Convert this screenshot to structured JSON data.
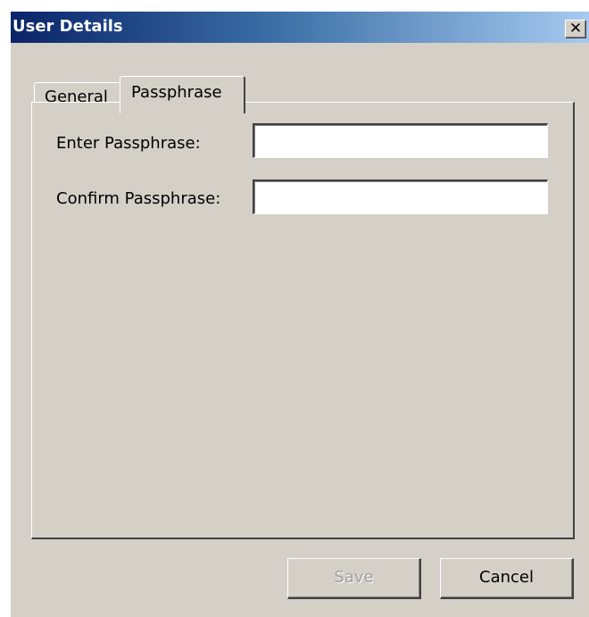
{
  "window": {
    "title": "User Details",
    "close_glyph": "✕"
  },
  "tabs": [
    {
      "label": "General",
      "selected": false
    },
    {
      "label": "Passphrase",
      "selected": true
    }
  ],
  "form": {
    "enter_label": "Enter Passphrase:",
    "enter_value": "",
    "confirm_label": "Confirm Passphrase:",
    "confirm_value": ""
  },
  "buttons": {
    "save_label": "Save",
    "save_enabled": false,
    "cancel_label": "Cancel"
  },
  "colors": {
    "dialog_face": "#d4d0c8",
    "titlebar_start": "#0a246a",
    "titlebar_end": "#a6caf0",
    "disabled_text": "#a0a0a0"
  }
}
